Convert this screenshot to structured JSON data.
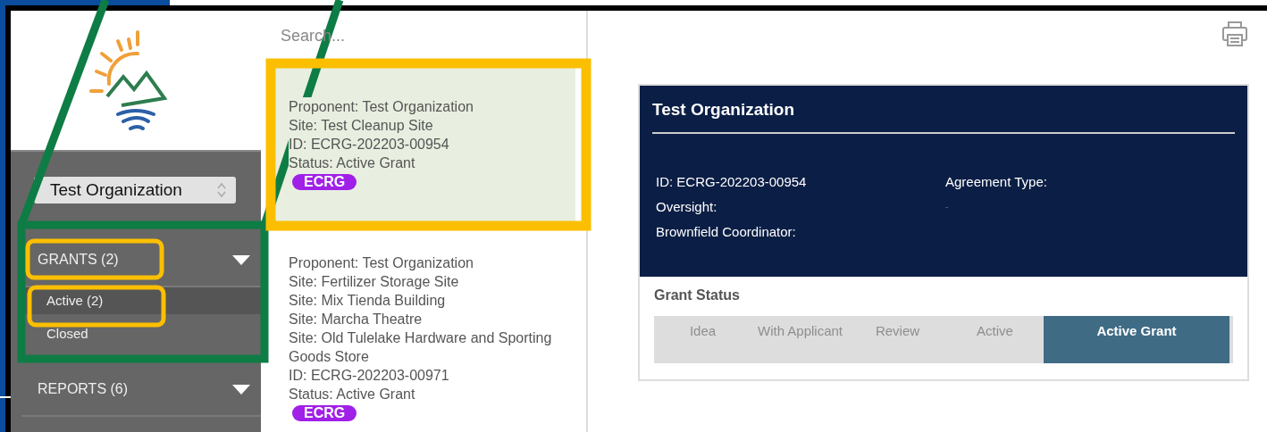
{
  "sidebar": {
    "organization_select": {
      "value": "Test Organization"
    },
    "sections": [
      {
        "label": "GRANTS (2)",
        "items": [
          {
            "label": "Active  (2)",
            "selected": true
          },
          {
            "label": "Closed",
            "selected": false
          }
        ]
      },
      {
        "label": "REPORTS (6)"
      }
    ]
  },
  "list": {
    "search": {
      "placeholder": "Search..."
    },
    "items": [
      {
        "selected": true,
        "lines": [
          "Proponent: Test Organization",
          "Site: Test Cleanup Site",
          "ID: ECRG-202203-00954",
          "Status: Active Grant"
        ],
        "tag": "ECRG"
      },
      {
        "selected": false,
        "lines": [
          "Proponent: Test Organization",
          "Site: Fertilizer Storage Site",
          "Site: Mix Tienda Building",
          "Site: Marcha Theatre",
          "Site: Old Tulelake Hardware and Sporting Goods Store",
          "ID: ECRG-202203-00971",
          "Status: Active Grant"
        ],
        "tag": "ECRG"
      }
    ]
  },
  "detail": {
    "title": "Test Organization",
    "left_fields": [
      "ID: ECRG-202203-00954",
      "Oversight:",
      "Brownfield Coordinator:"
    ],
    "right_fields": [
      "Agreement Type:",
      "-"
    ],
    "status_label": "Grant Status",
    "stages": [
      {
        "label": "Idea",
        "selected": false
      },
      {
        "label": "With Applicant",
        "selected": false
      },
      {
        "label": "Review",
        "selected": false
      },
      {
        "label": "Active",
        "selected": false
      },
      {
        "label": "Active Grant",
        "selected": true
      }
    ]
  }
}
